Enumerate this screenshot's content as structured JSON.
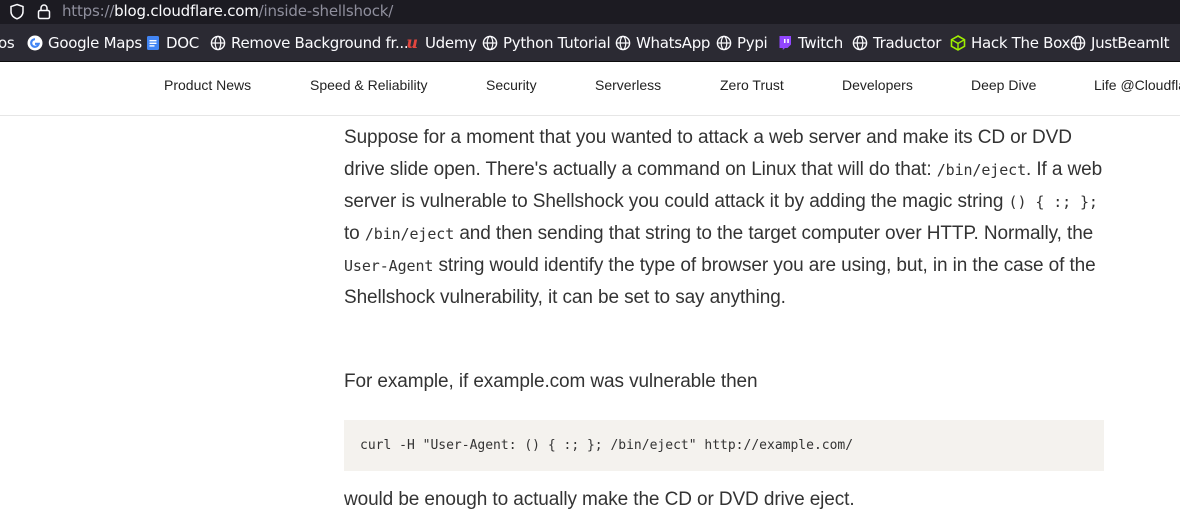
{
  "browser": {
    "url_scheme": "https://",
    "url_host": "blog.cloudflare.com",
    "url_path": "/inside-shellshock/"
  },
  "bookmarks": [
    {
      "label": "os",
      "icon": "none"
    },
    {
      "label": "Google Maps",
      "icon": "google-icon"
    },
    {
      "label": "DOC",
      "icon": "doc-icon"
    },
    {
      "label": "Remove Background fr...",
      "icon": "globe-icon"
    },
    {
      "label": "Udemy",
      "icon": "udemy-icon"
    },
    {
      "label": "Python Tutorial",
      "icon": "globe-icon"
    },
    {
      "label": "WhatsApp",
      "icon": "globe-icon"
    },
    {
      "label": "Pypi",
      "icon": "globe-icon"
    },
    {
      "label": "Twitch",
      "icon": "twitch-icon"
    },
    {
      "label": "Traductor",
      "icon": "globe-icon"
    },
    {
      "label": "Hack The Box",
      "icon": "htb-icon"
    },
    {
      "label": "JustBeamIt",
      "icon": "globe-icon"
    }
  ],
  "nav": {
    "items": [
      "Product News",
      "Speed & Reliability",
      "Security",
      "Serverless",
      "Zero Trust",
      "Developers",
      "Deep Dive",
      "Life @Cloudflare"
    ]
  },
  "article": {
    "p1": {
      "t1": "Suppose for a moment that you wanted to attack a web server and make its CD or DVD drive slide open. There's actually a command on Linux that will do that: ",
      "c1": "/bin/eject",
      "t2": ". If a web server is vulnerable to Shellshock you could attack it by adding the magic string ",
      "c2": "() { :; };",
      "t3": " to ",
      "c3": "/bin/eject",
      "t4": " and then sending that string to the target computer over HTTP. Normally, the ",
      "c4": "User-Agent",
      "t5": " string would identify the type of browser you are using, but, in in the case of the Shellshock vulnerability, it can be set to say anything."
    },
    "p2": "For example, if example.com was vulnerable then",
    "code": "curl -H \"User-Agent: () { :; }; /bin/eject\" http://example.com/",
    "p3": "would be enough to actually make the CD or DVD drive eject."
  },
  "colors": {
    "chrome_dark": "#1c1b22",
    "toolbar": "#2b2a33",
    "text": "#333333",
    "code_bg": "#f4f2ee",
    "udemy": "#a435f0",
    "twitch": "#9146ff",
    "htb": "#9fef00",
    "doc": "#4285f4"
  }
}
